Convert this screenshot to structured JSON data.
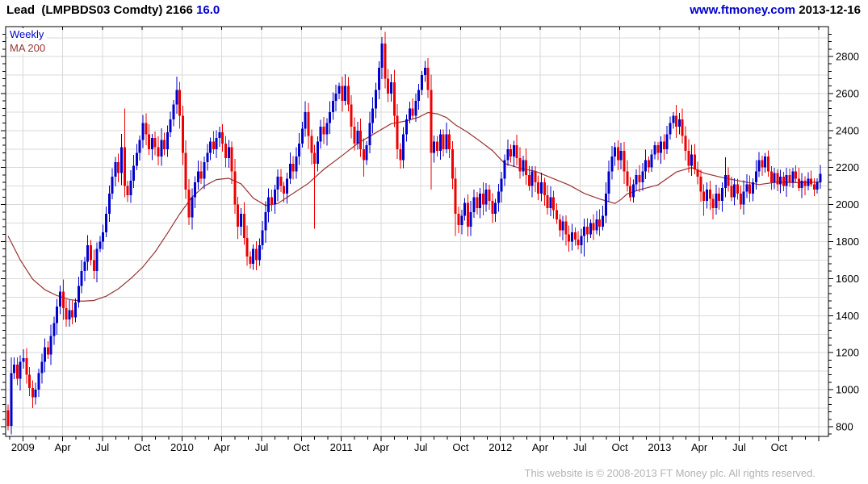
{
  "header": {
    "title_main": "Lead  (LMPBDS03 Comdty) 2166",
    "title_value": "16.0",
    "site": "www.ftmoney.com",
    "date": "2013-12-16"
  },
  "legend": {
    "series": "Weekly",
    "ma": "MA 200"
  },
  "footer": {
    "copyright": "This website is © 2008-2013 FT Money plc. All rights reserved."
  },
  "colors": {
    "up": "#0000cc",
    "down": "#ee0000",
    "ma": "#993333",
    "grid": "#d9d9d9",
    "axis": "#000000",
    "text_blue": "#0000cc",
    "muted": "#b3b3b3"
  },
  "chart_data": {
    "type": "candlestick",
    "title": "Lead (LMPBDS03 Comdty)",
    "periodicity": "Weekly",
    "overlay": "MA 200",
    "last_price": 2166,
    "last_change": "16.0",
    "x_axis": {
      "labels": [
        "2009",
        "Apr",
        "Jul",
        "Oct",
        "2010",
        "Apr",
        "Jul",
        "Oct",
        "2011",
        "Apr",
        "Jul",
        "Oct",
        "2012",
        "Apr",
        "Jul",
        "Oct",
        "2013",
        "Apr",
        "Jul",
        "Oct"
      ],
      "minor_tick": "monthly"
    },
    "y_axis": {
      "tick_labels": [
        800,
        1000,
        1200,
        1400,
        1600,
        1800,
        2000,
        2200,
        2400,
        2600,
        2800
      ],
      "minor_step": 40,
      "grid_step": 100,
      "ylim": [
        750,
        2960
      ]
    },
    "first_open": 890,
    "closes": [
      805,
      1090,
      1135,
      1060,
      1150,
      1170,
      1080,
      1010,
      960,
      1000,
      1090,
      1150,
      1230,
      1190,
      1290,
      1360,
      1450,
      1530,
      1440,
      1380,
      1430,
      1390,
      1470,
      1560,
      1640,
      1690,
      1780,
      1700,
      1640,
      1760,
      1800,
      1850,
      1950,
      2060,
      2150,
      2230,
      2170,
      2310,
      2100,
      2050,
      2130,
      2210,
      2280,
      2350,
      2440,
      2380,
      2300,
      2360,
      2310,
      2260,
      2350,
      2300,
      2390,
      2460,
      2540,
      2620,
      2480,
      2280,
      2080,
      1930,
      2040,
      2120,
      2180,
      2140,
      2230,
      2280,
      2340,
      2300,
      2360,
      2390,
      2330,
      2250,
      2310,
      2180,
      2000,
      1880,
      1950,
      1820,
      1720,
      1680,
      1760,
      1700,
      1780,
      1860,
      1960,
      2040,
      2000,
      2080,
      2150,
      2100,
      2060,
      2140,
      2220,
      2180,
      2260,
      2330,
      2410,
      2500,
      2370,
      2280,
      2220,
      2340,
      2420,
      2380,
      2440,
      2500,
      2560,
      2600,
      2640,
      2560,
      2640,
      2540,
      2420,
      2330,
      2400,
      2300,
      2240,
      2320,
      2440,
      2520,
      2620,
      2740,
      2870,
      2680,
      2600,
      2660,
      2480,
      2300,
      2240,
      2380,
      2460,
      2520,
      2480,
      2560,
      2620,
      2700,
      2740,
      2620,
      2280,
      2340,
      2290,
      2380,
      2300,
      2380,
      2300,
      2140,
      1950,
      1890,
      1940,
      2010,
      1880,
      1960,
      2040,
      1980,
      2060,
      2000,
      2080,
      2020,
      1950,
      2010,
      2070,
      2140,
      2240,
      2300,
      2260,
      2320,
      2250,
      2180,
      2240,
      2160,
      2100,
      2180,
      2120,
      2060,
      2120,
      2050,
      1980,
      2040,
      1970,
      1920,
      1860,
      1910,
      1840,
      1800,
      1850,
      1810,
      1780,
      1830,
      1880,
      1840,
      1900,
      1860,
      1920,
      1880,
      1940,
      2060,
      2180,
      2260,
      2310,
      2240,
      2290,
      2180,
      2100,
      2040,
      2110,
      2160,
      2120,
      2180,
      2240,
      2200,
      2270,
      2320,
      2280,
      2340,
      2300,
      2380,
      2440,
      2480,
      2420,
      2460,
      2370,
      2290,
      2210,
      2270,
      2190,
      2150,
      2070,
      2020,
      2080,
      2030,
      1980,
      2060,
      2020,
      2090,
      2160,
      2100,
      2040,
      2110,
      2060,
      2000,
      2070,
      2110,
      2060,
      2120,
      2180,
      2240,
      2200,
      2260,
      2180,
      2120,
      2170,
      2110,
      2150,
      2100,
      2160,
      2120,
      2180,
      2140,
      2090,
      2130,
      2100,
      2140,
      2110,
      2080,
      2120,
      2166
    ],
    "wick_overrides": [
      [
        8,
        null,
        900
      ],
      [
        38,
        2520,
        null
      ],
      [
        55,
        2690,
        null
      ],
      [
        59,
        null,
        1890
      ],
      [
        79,
        null,
        1655
      ],
      [
        100,
        null,
        1870
      ],
      [
        110,
        2705,
        null
      ],
      [
        116,
        null,
        2150
      ],
      [
        122,
        2905,
        null
      ],
      [
        128,
        null,
        2195
      ],
      [
        136,
        2775,
        null
      ],
      [
        138,
        null,
        2080
      ],
      [
        146,
        null,
        1830
      ],
      [
        147,
        null,
        1845
      ],
      [
        165,
        2345,
        null
      ],
      [
        188,
        null,
        1720
      ],
      [
        198,
        2335,
        null
      ],
      [
        217,
        2500,
        null
      ],
      [
        219,
        2495,
        null
      ],
      [
        227,
        null,
        1940
      ],
      [
        230,
        null,
        1920
      ],
      [
        234,
        2255,
        null
      ],
      [
        239,
        null,
        1975
      ],
      [
        247,
        2280,
        null
      ]
    ],
    "ma200_keypoints": [
      [
        0,
        1830
      ],
      [
        4,
        1700
      ],
      [
        8,
        1597
      ],
      [
        12,
        1540
      ],
      [
        16,
        1508
      ],
      [
        20,
        1487
      ],
      [
        24,
        1478
      ],
      [
        28,
        1482
      ],
      [
        32,
        1505
      ],
      [
        36,
        1545
      ],
      [
        40,
        1600
      ],
      [
        44,
        1663
      ],
      [
        48,
        1745
      ],
      [
        52,
        1845
      ],
      [
        56,
        1950
      ],
      [
        60,
        2040
      ],
      [
        64,
        2100
      ],
      [
        68,
        2135
      ],
      [
        72,
        2142
      ],
      [
        76,
        2112
      ],
      [
        80,
        2035
      ],
      [
        84,
        1995
      ],
      [
        88,
        2006
      ],
      [
        93,
        2060
      ],
      [
        98,
        2115
      ],
      [
        103,
        2190
      ],
      [
        109,
        2265
      ],
      [
        114,
        2330
      ],
      [
        119,
        2378
      ],
      [
        125,
        2437
      ],
      [
        130,
        2452
      ],
      [
        134,
        2472
      ],
      [
        137,
        2497
      ],
      [
        140,
        2490
      ],
      [
        143,
        2470
      ],
      [
        146,
        2430
      ],
      [
        150,
        2390
      ],
      [
        154,
        2342
      ],
      [
        158,
        2292
      ],
      [
        162,
        2222
      ],
      [
        167,
        2196
      ],
      [
        172,
        2180
      ],
      [
        177,
        2146
      ],
      [
        183,
        2106
      ],
      [
        188,
        2060
      ],
      [
        193,
        2030
      ],
      [
        198,
        2006
      ],
      [
        200,
        2028
      ],
      [
        202,
        2058
      ],
      [
        206,
        2080
      ],
      [
        212,
        2106
      ],
      [
        218,
        2176
      ],
      [
        223,
        2200
      ],
      [
        227,
        2170
      ],
      [
        233,
        2146
      ],
      [
        238,
        2130
      ],
      [
        245,
        2108
      ],
      [
        251,
        2122
      ],
      [
        258,
        2118
      ],
      [
        265,
        2122
      ]
    ]
  }
}
